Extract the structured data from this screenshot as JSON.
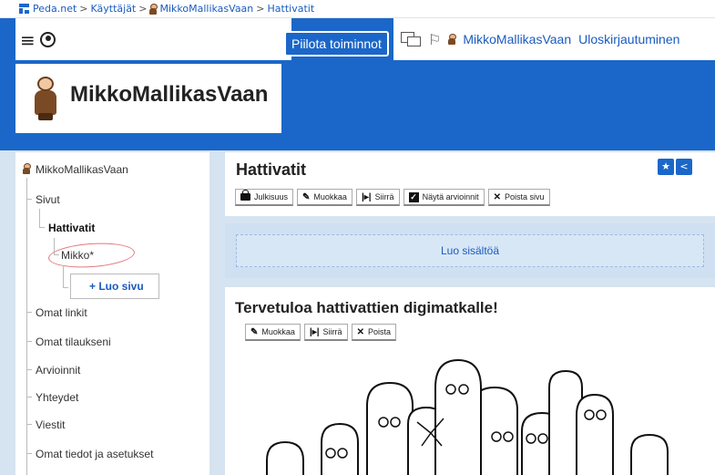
{
  "breadcrumb": {
    "items": [
      "Peda.net",
      "Käyttäjät",
      "MikkoMallikasVaan",
      "Hattivatit"
    ],
    "separator": ">"
  },
  "topbar": {
    "hide_label": "Piilota toiminnot",
    "user_label": "MikkoMallikasVaan",
    "logout_label": "Uloskirjautuminen"
  },
  "profile": {
    "name": "MikkoMallikasVaan"
  },
  "sidebar": {
    "root": "MikkoMallikasVaan",
    "items": [
      {
        "label": "Sivut"
      },
      {
        "label": "Hattivatit"
      },
      {
        "label": "Mikko*"
      },
      {
        "label": "Omat linkit"
      },
      {
        "label": "Omat tilaukseni"
      },
      {
        "label": "Arvioinnit"
      },
      {
        "label": "Yhteydet"
      },
      {
        "label": "Viestit"
      },
      {
        "label": "Omat tiedot ja asetukset"
      }
    ],
    "new_page_label": "+ Luo sivu"
  },
  "page": {
    "title": "Hattivatit",
    "actions": [
      "Julkisuus",
      "Muokkaa",
      "Siirrä",
      "Näytä arvioinnit",
      "Poista sivu"
    ],
    "create_label": "Luo sisältöä"
  },
  "card": {
    "title": "Tervetuloa hattivattien digimatkalle!",
    "actions": [
      "Muokkaa",
      "Siirrä",
      "Poista"
    ]
  },
  "colors": {
    "brand_blue": "#1b67c9",
    "link": "#1a5bbf",
    "annotation_red": "#e2797e"
  }
}
